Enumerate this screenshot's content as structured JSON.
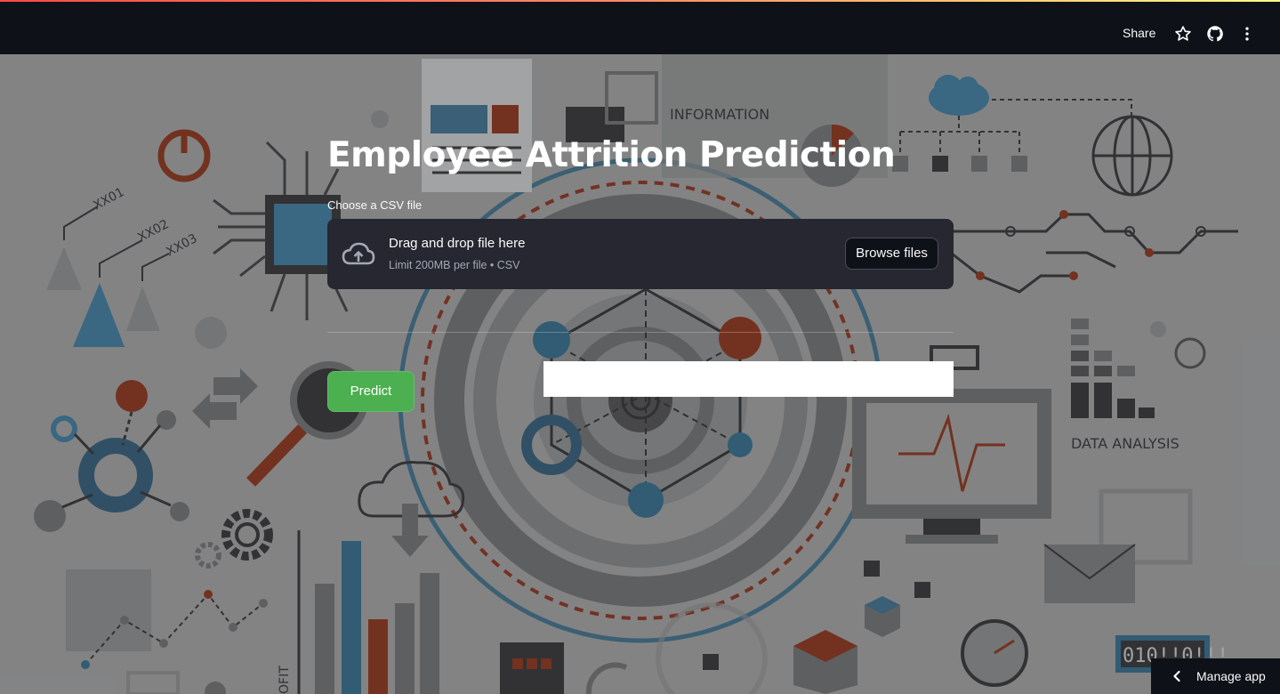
{
  "header": {
    "share_label": "Share",
    "icons": [
      "star-icon",
      "github-icon",
      "more-vertical-icon"
    ]
  },
  "background": {
    "labels": {
      "information": "INFORMATION",
      "data_analysis": "DATA ANALYSIS",
      "xx01": "XX01",
      "xx02": "XX02",
      "xx03": "XX03",
      "binary": "010!!0!!!",
      "profit": "OFIT"
    }
  },
  "main": {
    "title": "Employee Attrition Prediction",
    "uploader": {
      "label": "Choose a CSV file",
      "drag_text": "Drag and drop file here",
      "limit_text": "Limit 200MB per file • CSV",
      "browse_label": "Browse files",
      "icon": "cloud-upload-icon"
    },
    "predict_label": "Predict",
    "result_text": ""
  },
  "footer": {
    "manage_app_label": "Manage app"
  },
  "colors": {
    "header_bg": "#0e1117",
    "dropzone_bg": "#262730",
    "predict_bg": "#4caf50",
    "accent_red": "#ff4b4b",
    "accent_yellow": "#fffd80"
  }
}
